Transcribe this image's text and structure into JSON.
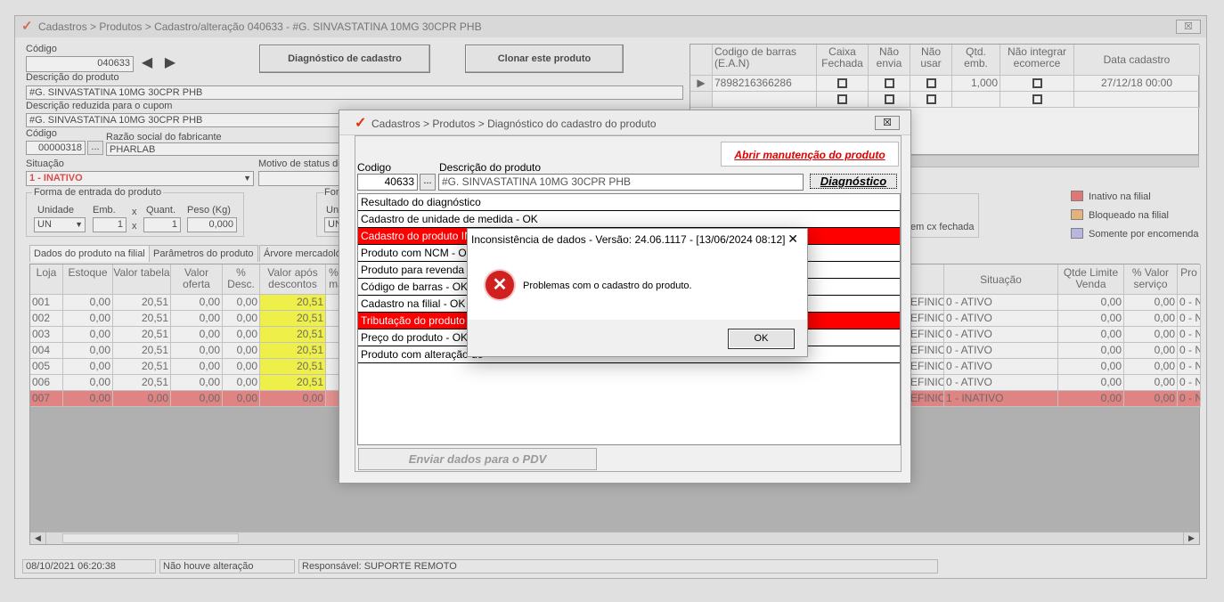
{
  "main_window": {
    "title": "Cadastros > Produtos > Cadastro/alteração  040633 - #G. SINVASTATINA 10MG 30CPR PHB",
    "close_label": "☒",
    "codigo_label": "Código",
    "codigo_value": "040633",
    "diagnostico_button": "Diagnóstico de cadastro",
    "clonar_button": "Clonar este produto",
    "descricao_label": "Descrição  do produto",
    "descricao_value": "#G. SINVASTATINA 10MG 30CPR PHB",
    "desc_reduzida_label": "Descrição reduzida para o cupom",
    "desc_reduzida_value": "#G. SINVASTATINA 10MG 30CPR PHB",
    "fab_codigo_label": "Código",
    "fab_codigo_value": "00000318",
    "fab_razao_label": "Razão social do fabricante",
    "fab_razao_value": "PHARLAB",
    "situacao_label": "Situação",
    "situacao_value": "1 - INATIVO",
    "motivo_label": "Motivo de status do p",
    "entrada_group": "Forma de entrada do produto",
    "unidade_label": "Unidade",
    "unidade_value": "UN",
    "emb_label": "Emb.",
    "emb_value": "1",
    "quant_label": "Quant.",
    "quant_value": "1",
    "peso_label": "Peso (Kg)",
    "peso_value": "0,000",
    "x_sign": "x",
    "forma2_label": "Forma",
    "unidade2_label": "Unida",
    "unidade2_value": "UN",
    "cx_fechada": "em cx fechada",
    "legend": [
      {
        "label": "Inativo na filial",
        "color": "#e84646"
      },
      {
        "label": "Bloqueado na filial",
        "color": "#f0a050"
      },
      {
        "label": "Somente por encomenda",
        "color": "#a8a8e8"
      }
    ],
    "tabs": [
      "Dados do produto na filial",
      "Parâmetros do produto",
      "Árvore mercadológic"
    ],
    "status_date": "08/10/2021 06:20:38",
    "status_change": "Não houve alteração",
    "status_resp": "Responsável: SUPORTE REMOTO"
  },
  "barcode_grid": {
    "headers": [
      "Codigo de barras (E.A.N)",
      "Caixa Fechada",
      "Não envia",
      "Não usar",
      "Qtd. emb.",
      "Não integrar ecomerce",
      "Data cadastro"
    ],
    "row": {
      "ean": "7898216366286",
      "qtd": "1,000",
      "data": "27/12/18 00:00"
    }
  },
  "store_grid": {
    "headers": [
      "Loja",
      "Estoque",
      "Valor tabela",
      "Valor oferta",
      "% Desc.",
      "Valor após descontos",
      "% D máx"
    ],
    "right_headers": [
      "Situação",
      "Qtde Limite Venda",
      "% Valor serviço",
      "Pro"
    ],
    "rows": [
      {
        "loja": "001",
        "estoque": "0,00",
        "tabela": "20,51",
        "oferta": "0,00",
        "desc": "0,00",
        "apos": "20,51",
        "tipo": "EFINIC",
        "situacao": "0 - ATIVO",
        "limite": "0,00",
        "servico": "0,00",
        "pro": "0 - N"
      },
      {
        "loja": "002",
        "estoque": "0,00",
        "tabela": "20,51",
        "oferta": "0,00",
        "desc": "0,00",
        "apos": "20,51",
        "tipo": "EFINIC",
        "situacao": "0 - ATIVO",
        "limite": "0,00",
        "servico": "0,00",
        "pro": "0 - N"
      },
      {
        "loja": "003",
        "estoque": "0,00",
        "tabela": "20,51",
        "oferta": "0,00",
        "desc": "0,00",
        "apos": "20,51",
        "tipo": "EFINIC",
        "situacao": "0 - ATIVO",
        "limite": "0,00",
        "servico": "0,00",
        "pro": "0 - N"
      },
      {
        "loja": "004",
        "estoque": "0,00",
        "tabela": "20,51",
        "oferta": "0,00",
        "desc": "0,00",
        "apos": "20,51",
        "tipo": "EFINIC",
        "situacao": "0 - ATIVO",
        "limite": "0,00",
        "servico": "0,00",
        "pro": "0 - N"
      },
      {
        "loja": "005",
        "estoque": "0,00",
        "tabela": "20,51",
        "oferta": "0,00",
        "desc": "0,00",
        "apos": "20,51",
        "tipo": "EFINIC",
        "situacao": "0 - ATIVO",
        "limite": "0,00",
        "servico": "0,00",
        "pro": "0 - N"
      },
      {
        "loja": "006",
        "estoque": "0,00",
        "tabela": "20,51",
        "oferta": "0,00",
        "desc": "0,00",
        "apos": "20,51",
        "tipo": "EFINIC",
        "situacao": "0 - ATIVO",
        "limite": "0,00",
        "servico": "0,00",
        "pro": "0 - N"
      },
      {
        "loja": "007",
        "estoque": "0,00",
        "tabela": "0,00",
        "oferta": "0,00",
        "desc": "0,00",
        "apos": "0,00",
        "tipo": "EFINIC",
        "situacao": "1 - INATIVO",
        "limite": "0,00",
        "servico": "0,00",
        "pro": "0 - N"
      }
    ]
  },
  "diag_dialog": {
    "title": "Cadastros > Produtos > Diagnóstico do cadastro do produto",
    "close_label": "☒",
    "abrir_button": "Abrir manutenção do produto",
    "codigo_label": "Codigo",
    "codigo_value": "40633",
    "ellipsis": "...",
    "descricao_label": "Descrição do produto",
    "descricao_value": "#G. SINVASTATINA 10MG 30CPR PHB",
    "diagnostico_button": "Diagnóstico",
    "results": [
      {
        "text": "Resultado do diagnóstico",
        "error": false
      },
      {
        "text": "Cadastro de unidade de medida - OK",
        "error": false
      },
      {
        "text": "Cadastro do produto INAT",
        "error": true
      },
      {
        "text": "Produto com NCM - OK",
        "error": false
      },
      {
        "text": "Produto para revenda - C",
        "error": false
      },
      {
        "text": "Código de barras - OK",
        "error": false
      },
      {
        "text": "Cadastro na filial - OK",
        "error": false
      },
      {
        "text": "Tributação do produto - N",
        "error": true
      },
      {
        "text": "Preço do produto - OK",
        "error": false
      },
      {
        "text": "Produto com alteração de",
        "error": false
      }
    ],
    "enviar_button": "Enviar dados para o PDV"
  },
  "message_box": {
    "title": "Inconsistência de dados - Versão: 24.06.1117 - [13/06/2024 08:12]",
    "close_label": "✕",
    "icon_glyph": "✕",
    "message": "Problemas com o cadastro do produto.",
    "ok_button": "OK"
  }
}
